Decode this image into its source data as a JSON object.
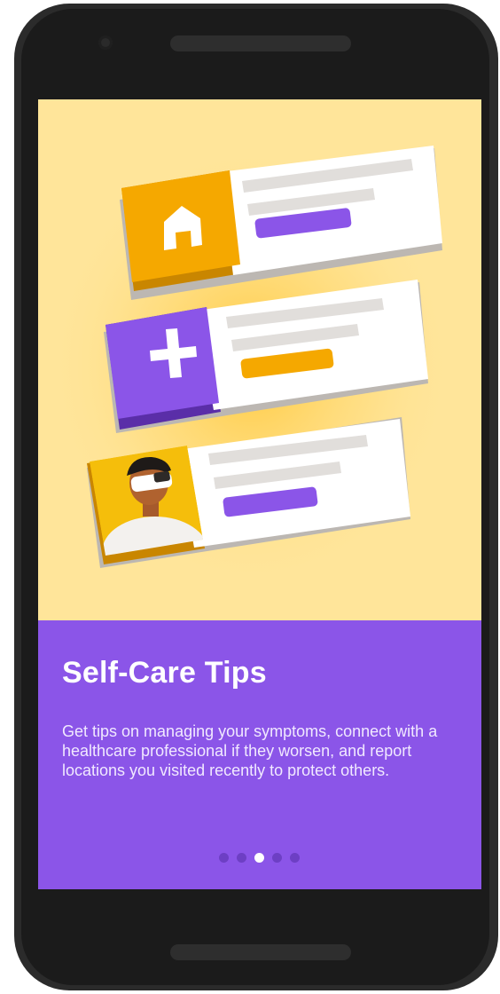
{
  "onboarding": {
    "title": "Self-Care Tips",
    "description": "Get tips on managing your symptoms, connect with a healthcare professional if they worsen, and report locations you visited recently to protect others.",
    "pagination": {
      "total": 5,
      "active_index": 2
    }
  },
  "illustration": {
    "cards": [
      {
        "icon": "home-icon",
        "accent": "#f5a800",
        "button_color": "#8b55e8"
      },
      {
        "icon": "medical-plus-icon",
        "accent": "#8b55e8",
        "button_color": "#f5a800"
      },
      {
        "icon": "masked-person-avatar",
        "accent": "#f5be0b",
        "button_color": "#8b55e8"
      }
    ]
  },
  "colors": {
    "hero_background": "#ffe59a",
    "panel_background": "#8b55e8",
    "dot_inactive": "#6d3fc4",
    "dot_active": "#ffffff"
  }
}
